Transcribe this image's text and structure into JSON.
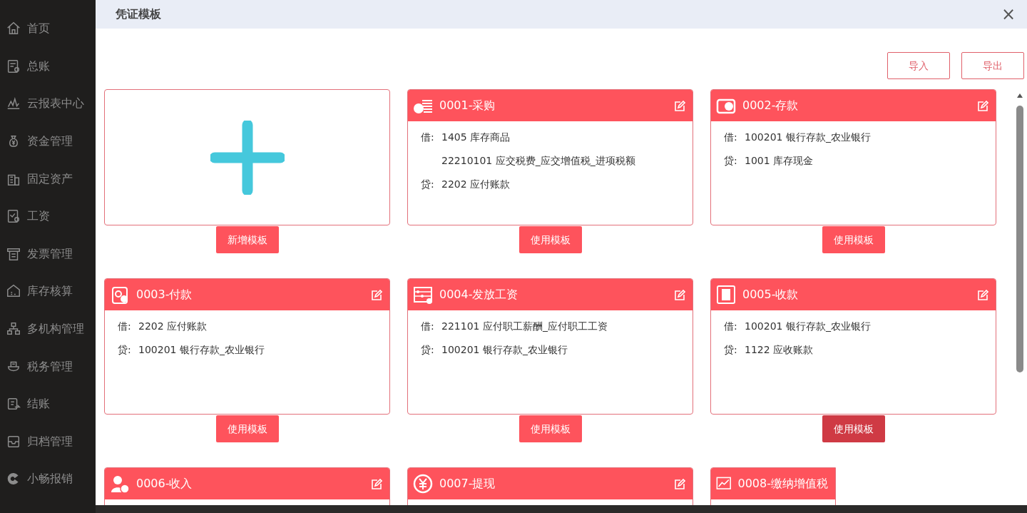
{
  "sidebar": {
    "items": [
      {
        "label": "首页"
      },
      {
        "label": "总账"
      },
      {
        "label": "云报表中心"
      },
      {
        "label": "资金管理"
      },
      {
        "label": "固定资产"
      },
      {
        "label": "工资"
      },
      {
        "label": "发票管理"
      },
      {
        "label": "库存核算"
      },
      {
        "label": "多机构管理"
      },
      {
        "label": "税务管理"
      },
      {
        "label": "结账"
      },
      {
        "label": "归档管理"
      },
      {
        "label": "小畅报销"
      }
    ]
  },
  "dialog": {
    "title": "凭证模板",
    "close": "×",
    "toolbar": [
      "导入",
      "导出"
    ],
    "add_card": {
      "button": "新增模板"
    },
    "templates": [
      {
        "title": "0001-采购",
        "entries": [
          {
            "side": "借:",
            "account": "1405 库存商品"
          },
          {
            "account": "22210101 应交税费_应交增值税_进项税额"
          },
          {
            "side": "贷:",
            "account": "2202 应付账款"
          }
        ],
        "button": "使用模板",
        "highlighted": false
      },
      {
        "title": "0002-存款",
        "entries": [
          {
            "side": "借:",
            "account": "100201 银行存款_农业银行"
          },
          {
            "side": "贷:",
            "account": "1001 库存现金"
          }
        ],
        "button": "使用模板",
        "highlighted": false
      },
      {
        "title": "0003-付款",
        "entries": [
          {
            "side": "借:",
            "account": "2202 应付账款"
          },
          {
            "side": "贷:",
            "account": "100201 银行存款_农业银行"
          }
        ],
        "button": "使用模板",
        "highlighted": false
      },
      {
        "title": "0004-发放工资",
        "entries": [
          {
            "side": "借:",
            "account": "221101 应付职工薪酬_应付职工工资"
          },
          {
            "side": "贷:",
            "account": "100201 银行存款_农业银行"
          }
        ],
        "button": "使用模板",
        "highlighted": false
      },
      {
        "title": "0005-收款",
        "entries": [
          {
            "side": "借:",
            "account": "100201 银行存款_农业银行"
          },
          {
            "side": "贷:",
            "account": "1122 应收账款"
          }
        ],
        "button": "使用模板",
        "highlighted": true
      },
      {
        "title": "0006-收入"
      },
      {
        "title": "0007-提现"
      },
      {
        "title": "0008-缴纳增值税",
        "clipped": true
      }
    ]
  }
}
